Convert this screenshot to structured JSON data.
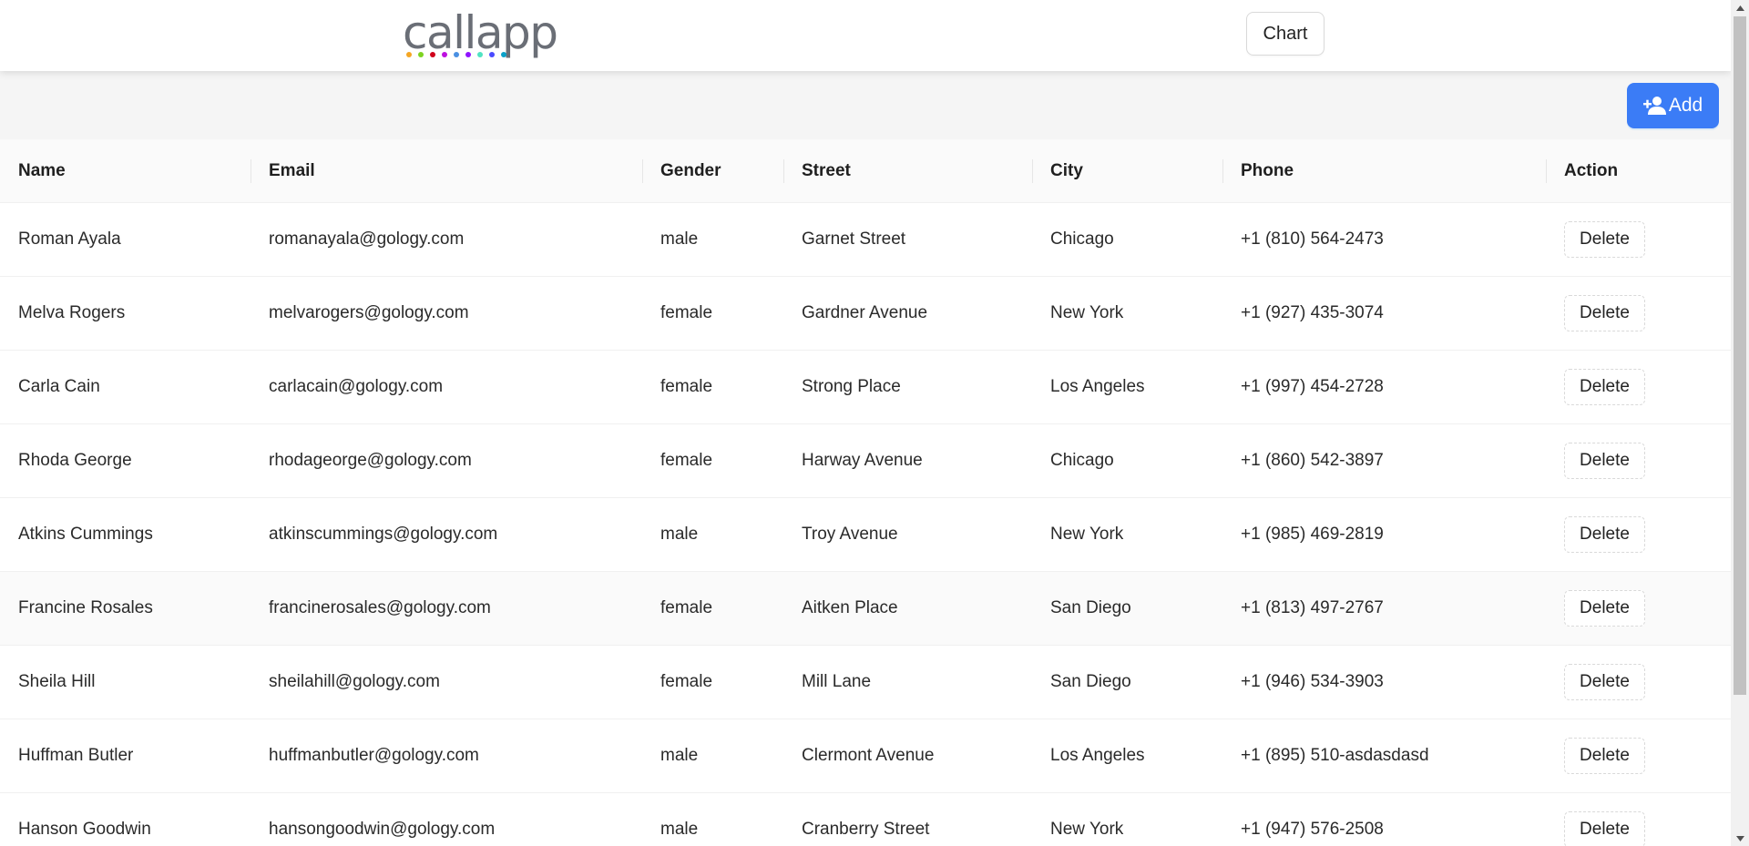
{
  "header": {
    "logo_text": "callapp",
    "logo_dot_colors": [
      "#f5a623",
      "#7ed321",
      "#d0021b",
      "#bd10e0",
      "#4a90e2",
      "#9013fe",
      "#50e3c2",
      "#4a4aff",
      "#0aa1c9"
    ],
    "chart_label": "Chart"
  },
  "toolbar": {
    "add_label": "Add",
    "add_icon": "user-add-icon",
    "accent_color": "#3b7cf6"
  },
  "table": {
    "columns": [
      "Name",
      "Email",
      "Gender",
      "Street",
      "City",
      "Phone",
      "Action"
    ],
    "delete_label": "Delete",
    "rows": [
      {
        "name": "Roman Ayala",
        "email": "romanayala@gology.com",
        "gender": "male",
        "street": "Garnet Street",
        "city": "Chicago",
        "phone": "+1 (810) 564-2473"
      },
      {
        "name": "Melva Rogers",
        "email": "melvarogers@gology.com",
        "gender": "female",
        "street": "Gardner Avenue",
        "city": "New York",
        "phone": "+1 (927) 435-3074"
      },
      {
        "name": "Carla Cain",
        "email": "carlacain@gology.com",
        "gender": "female",
        "street": "Strong Place",
        "city": "Los Angeles",
        "phone": "+1 (997) 454-2728"
      },
      {
        "name": "Rhoda George",
        "email": "rhodageorge@gology.com",
        "gender": "female",
        "street": "Harway Avenue",
        "city": "Chicago",
        "phone": "+1 (860) 542-3897"
      },
      {
        "name": "Atkins Cummings",
        "email": "atkinscummings@gology.com",
        "gender": "male",
        "street": "Troy Avenue",
        "city": "New York",
        "phone": "+1 (985) 469-2819"
      },
      {
        "name": "Francine Rosales",
        "email": "francinerosales@gology.com",
        "gender": "female",
        "street": "Aitken Place",
        "city": "San Diego",
        "phone": "+1 (813) 497-2767"
      },
      {
        "name": "Sheila Hill",
        "email": "sheilahill@gology.com",
        "gender": "female",
        "street": "Mill Lane",
        "city": "San Diego",
        "phone": "+1 (946) 534-3903"
      },
      {
        "name": "Huffman Butler",
        "email": "huffmanbutler@gology.com",
        "gender": "male",
        "street": "Clermont Avenue",
        "city": "Los Angeles",
        "phone": "+1 (895) 510-asdasdasd"
      },
      {
        "name": "Hanson Goodwin",
        "email": "hansongoodwin@gology.com",
        "gender": "male",
        "street": "Cranberry Street",
        "city": "New York",
        "phone": "+1 (947) 576-2508"
      }
    ]
  }
}
